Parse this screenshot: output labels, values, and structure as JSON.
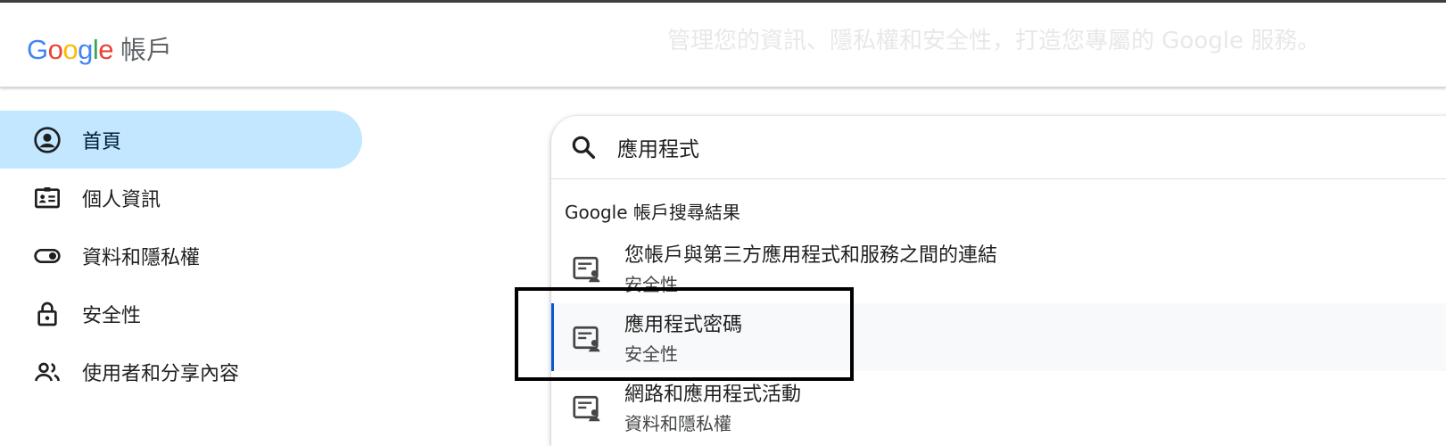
{
  "header": {
    "logo_text": "Google",
    "product_name": "帳戶",
    "tagline": "管理您的資訊、隱私權和安全性，打造您專屬的 Google 服務。"
  },
  "nav": {
    "items": [
      {
        "label": "首頁",
        "icon": "account-circle-icon",
        "active": true
      },
      {
        "label": "個人資訊",
        "icon": "id-card-icon",
        "active": false
      },
      {
        "label": "資料和隱私權",
        "icon": "toggle-icon",
        "active": false
      },
      {
        "label": "安全性",
        "icon": "lock-icon",
        "active": false
      },
      {
        "label": "使用者和分享內容",
        "icon": "people-icon",
        "active": false
      }
    ]
  },
  "search": {
    "query": "應用程式",
    "results_header": "Google 帳戶搜尋結果",
    "results": [
      {
        "title": "您帳戶與第三方應用程式和服務之間的連結",
        "subtitle": "安全性",
        "icon": "manage-account-icon",
        "highlighted": false
      },
      {
        "title": "應用程式密碼",
        "subtitle": "安全性",
        "icon": "manage-account-icon",
        "highlighted": true
      },
      {
        "title": "網路和應用程式活動",
        "subtitle": "資料和隱私權",
        "icon": "manage-account-icon",
        "highlighted": false
      }
    ]
  },
  "colors": {
    "active_nav_bg": "#c2e7ff",
    "highlight_bar": "#0b57d0",
    "annotation_box": "#000000"
  }
}
